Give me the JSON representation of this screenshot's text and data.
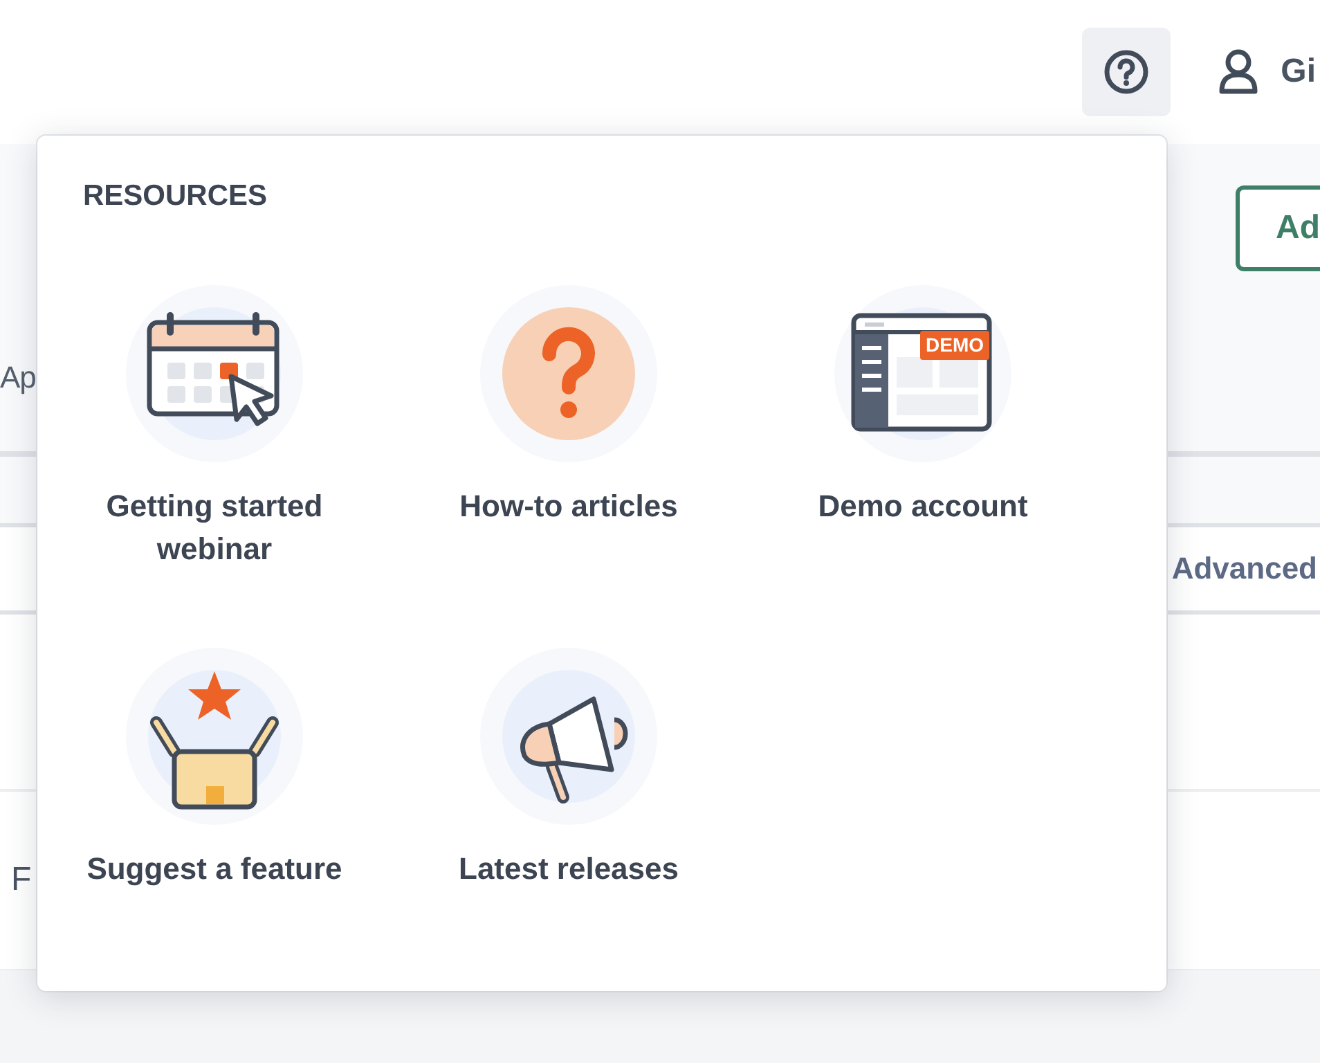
{
  "header": {
    "help_button": {
      "active": true
    },
    "user_name": "Gi"
  },
  "background": {
    "action_button": "Ad",
    "tab_label": "Ap",
    "filter_label": "Advanced",
    "row_label": "F"
  },
  "popup": {
    "title": "RESOURCES",
    "items": [
      {
        "kind": "webinar",
        "label": "Getting started webinar"
      },
      {
        "kind": "articles",
        "label": "How-to articles"
      },
      {
        "kind": "demo",
        "label": "Demo account",
        "badge": "DEMO"
      },
      {
        "kind": "feature",
        "label": "Suggest a feature"
      },
      {
        "kind": "releases",
        "label": "Latest releases"
      }
    ]
  }
}
